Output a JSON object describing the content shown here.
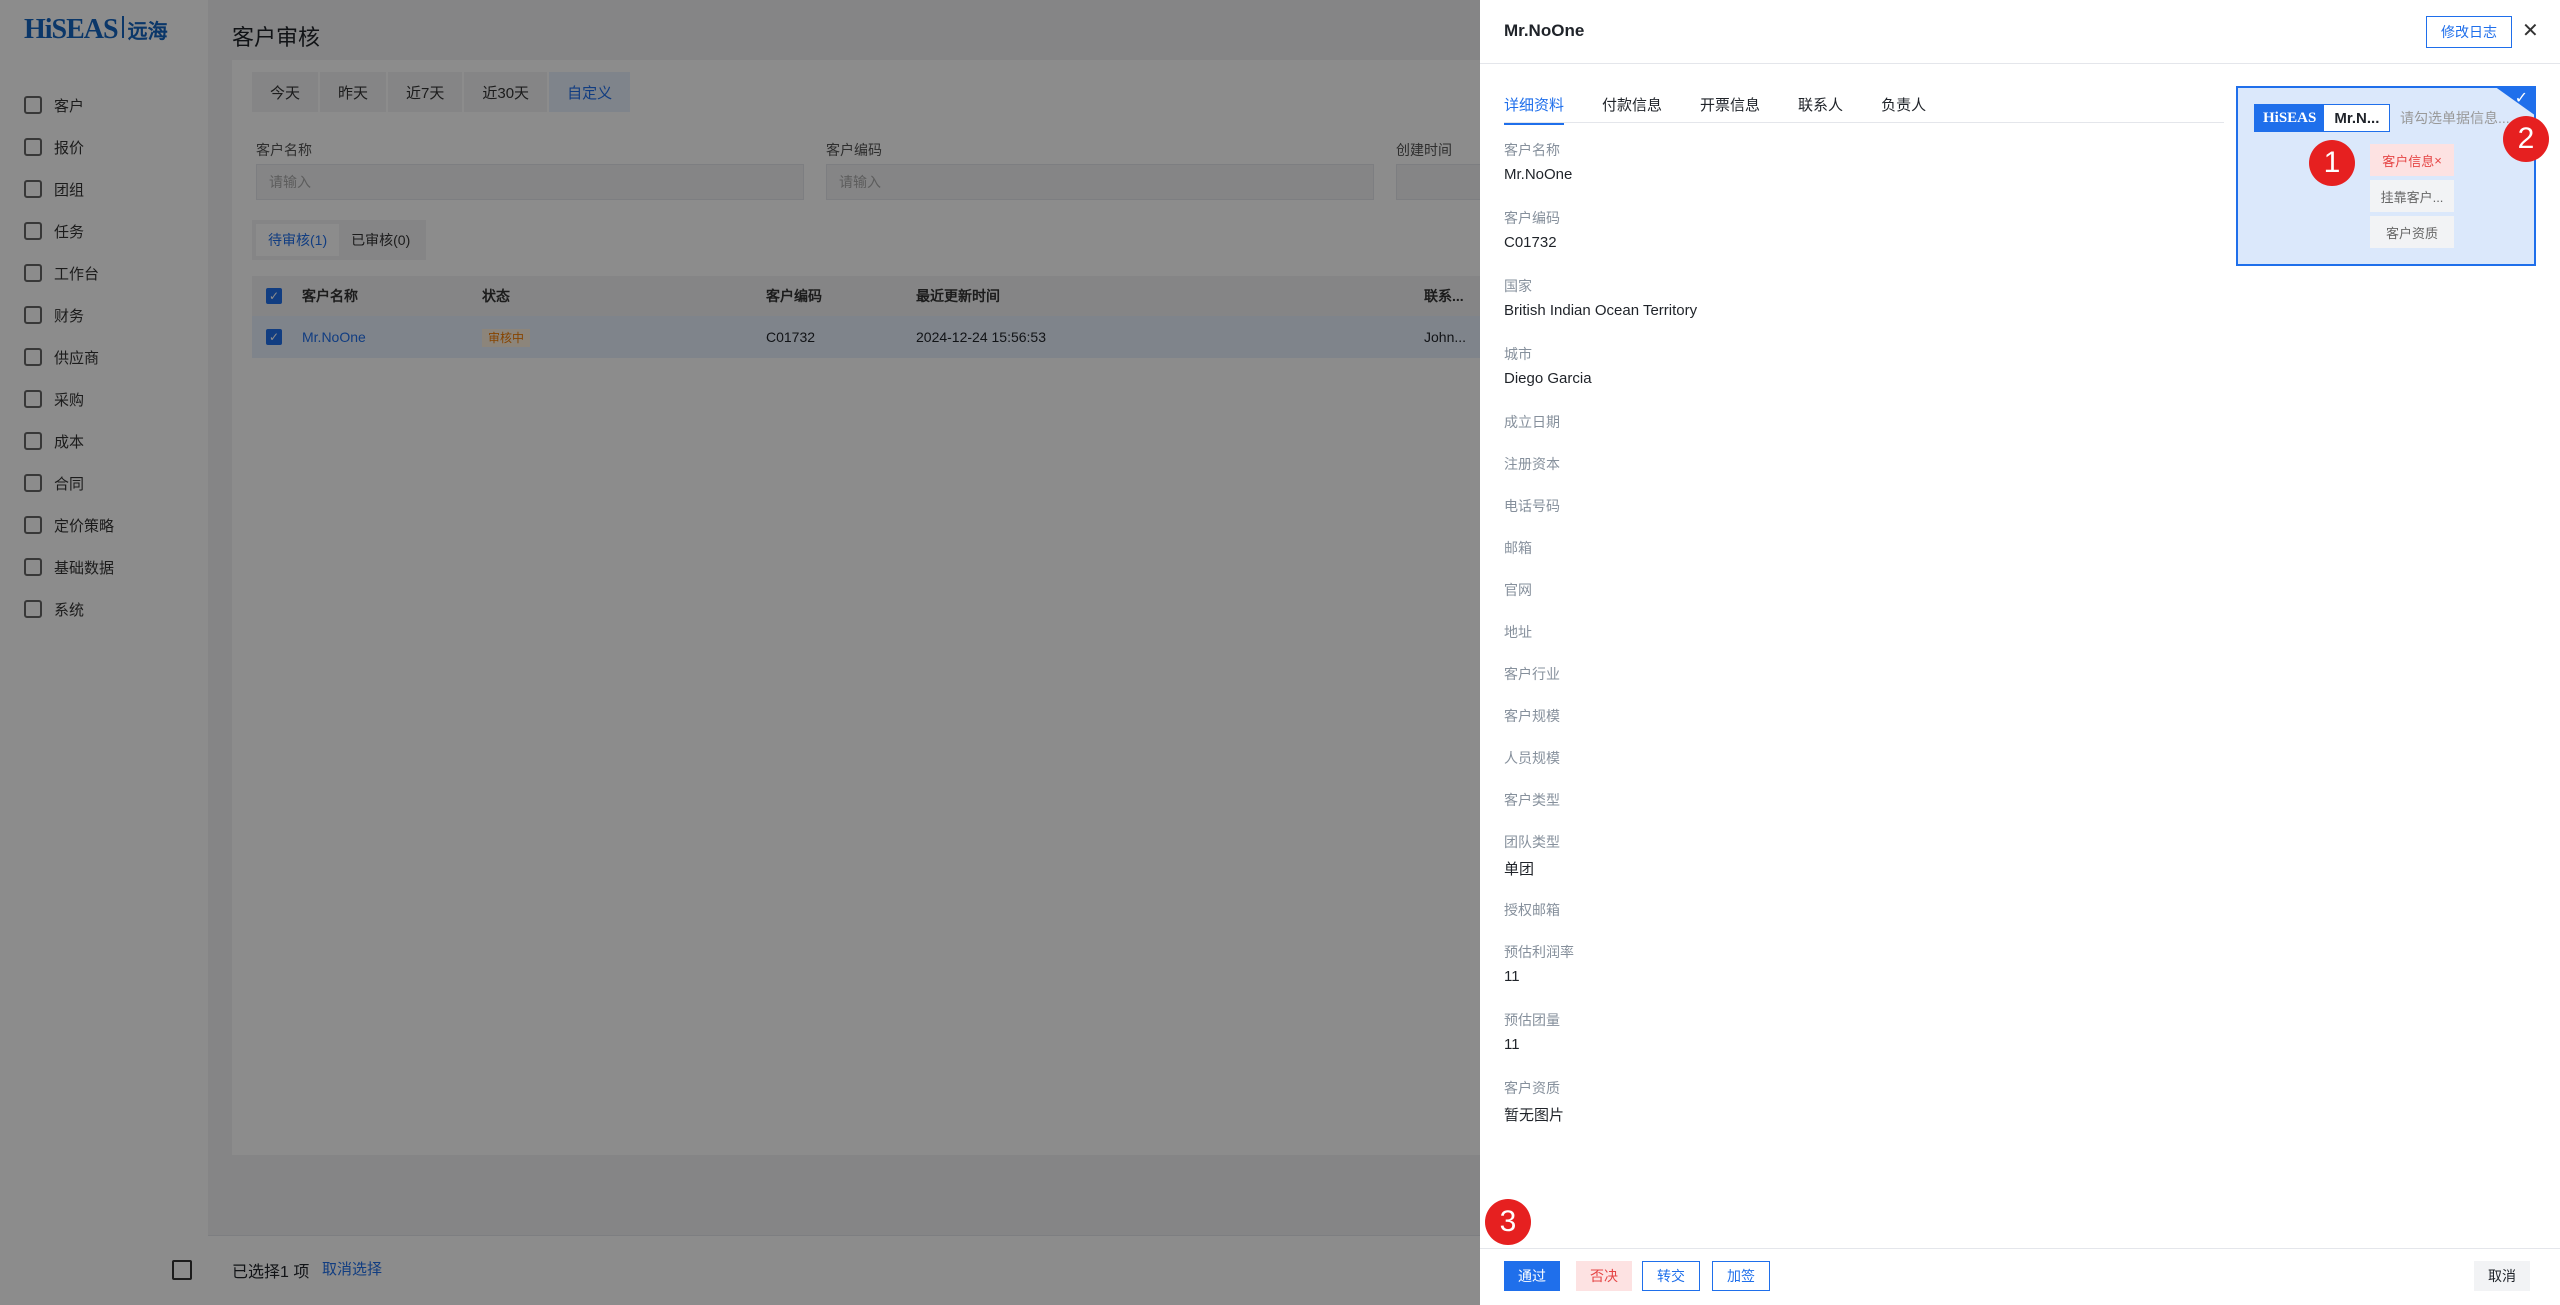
{
  "logo": {
    "brand": "HiSEAS",
    "cn": "远海"
  },
  "nav": [
    "客户",
    "报价",
    "团组",
    "任务",
    "工作台",
    "财务",
    "供应商",
    "采购",
    "成本",
    "合同",
    "定价策略",
    "基础数据",
    "系统"
  ],
  "page_title": "客户审核",
  "date_tabs": [
    "今天",
    "昨天",
    "近7天",
    "近30天",
    "自定义"
  ],
  "filters": {
    "name_label": "客户名称",
    "name_placeholder": "请输入",
    "code_label": "客户编码",
    "code_placeholder": "请输入",
    "created_label": "创建时间"
  },
  "status_tabs": [
    "待审核(1)",
    "已审核(0)"
  ],
  "table": {
    "headers": [
      "客户名称",
      "状态",
      "客户编码",
      "最近更新时间",
      "联系..."
    ],
    "row": {
      "name": "Mr.NoOne",
      "status": "审核中",
      "code": "C01732",
      "updated": "2024-12-24 15:56:53",
      "contact": "John..."
    }
  },
  "bottom": {
    "selected": "已选择1 项",
    "cancel": "取消选择"
  },
  "drawer": {
    "title": "Mr.NoOne",
    "log_button": "修改日志",
    "tabs": [
      "详细资料",
      "付款信息",
      "开票信息",
      "联系人",
      "负责人"
    ],
    "fields": [
      {
        "label": "客户名称",
        "value": "Mr.NoOne"
      },
      {
        "label": "客户编码",
        "value": "C01732"
      },
      {
        "label": "国家",
        "value": "British Indian Ocean Territory"
      },
      {
        "label": "城市",
        "value": "Diego Garcia"
      },
      {
        "label": "成立日期",
        "value": ""
      },
      {
        "label": "注册资本",
        "value": ""
      },
      {
        "label": "电话号码",
        "value": ""
      },
      {
        "label": "邮箱",
        "value": ""
      },
      {
        "label": "官网",
        "value": ""
      },
      {
        "label": "地址",
        "value": ""
      },
      {
        "label": "客户行业",
        "value": ""
      },
      {
        "label": "客户规模",
        "value": ""
      },
      {
        "label": "人员规模",
        "value": ""
      },
      {
        "label": "客户类型",
        "value": ""
      },
      {
        "label": "团队类型",
        "value": "单团"
      },
      {
        "label": "授权邮箱",
        "value": ""
      },
      {
        "label": "预估利润率",
        "value": "11"
      },
      {
        "label": "预估团量",
        "value": "11"
      },
      {
        "label": "客户资质",
        "value": "暂无图片"
      }
    ],
    "selector": {
      "brand": "HiSEAS",
      "name": "Mr.N...",
      "placeholder": "请勾选单据信息...",
      "options": [
        "客户信息",
        "挂靠客户...",
        "客户资质"
      ]
    },
    "badges": [
      "1",
      "2",
      "3"
    ],
    "footer": {
      "approve": "通过",
      "reject": "否决",
      "transfer": "转交",
      "add_sign": "加签",
      "cancel": "取消"
    }
  },
  "colors": {
    "primary": "#1f6feb",
    "danger": "#e54545",
    "badge": "#e62020"
  }
}
